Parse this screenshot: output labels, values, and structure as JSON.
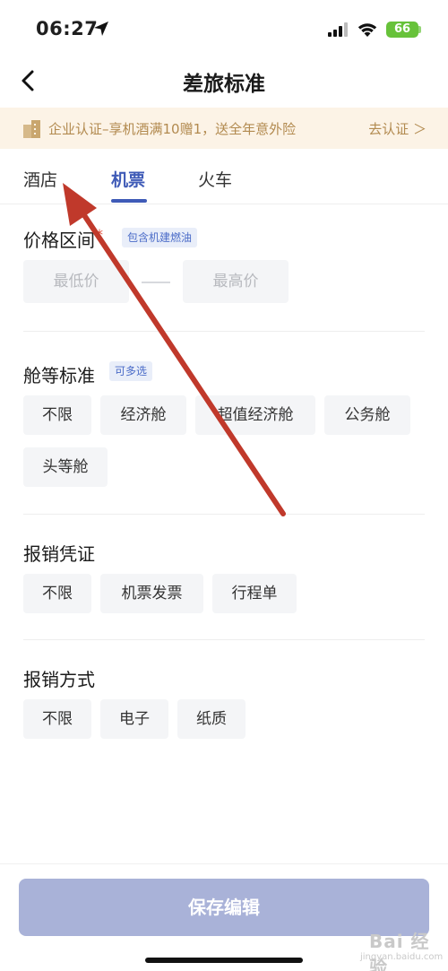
{
  "status_bar": {
    "time": "06:27",
    "battery": "66"
  },
  "nav": {
    "title": "差旅标准"
  },
  "banner": {
    "text": "企业认证–享机酒满10赠1，送全年意外险",
    "link": "去认证 ＞"
  },
  "tabs": [
    {
      "label": "酒店",
      "active": false
    },
    {
      "label": "机票",
      "active": true
    },
    {
      "label": "火车",
      "active": false
    }
  ],
  "price": {
    "title": "价格区间",
    "required_mark": "*",
    "tag": "包含机建燃油",
    "min_placeholder": "最低价",
    "max_placeholder": "最高价"
  },
  "cabin": {
    "title": "舱等标准",
    "tag": "可多选",
    "options": [
      "不限",
      "经济舱",
      "超值经济舱",
      "公务舱",
      "头等舱"
    ]
  },
  "voucher": {
    "title": "报销凭证",
    "options": [
      "不限",
      "机票发票",
      "行程单"
    ]
  },
  "method": {
    "title": "报销方式",
    "options": [
      "不限",
      "电子",
      "纸质"
    ]
  },
  "footer": {
    "save_label": "保存编辑"
  },
  "watermark": {
    "text": "Bai 经验",
    "sub": "jingyan.baidu.com"
  },
  "colors": {
    "accent": "#3f5bb7",
    "save_button": "#a9b2d8",
    "banner_bg": "#fcf3e6",
    "banner_text": "#b28a4f",
    "arrow": "#c0392b",
    "battery": "#67c23a"
  },
  "icons": [
    "location-arrow-icon",
    "signal-icon",
    "wifi-icon",
    "battery-icon",
    "back-icon",
    "building-icon",
    "annotation-arrow-icon"
  ]
}
